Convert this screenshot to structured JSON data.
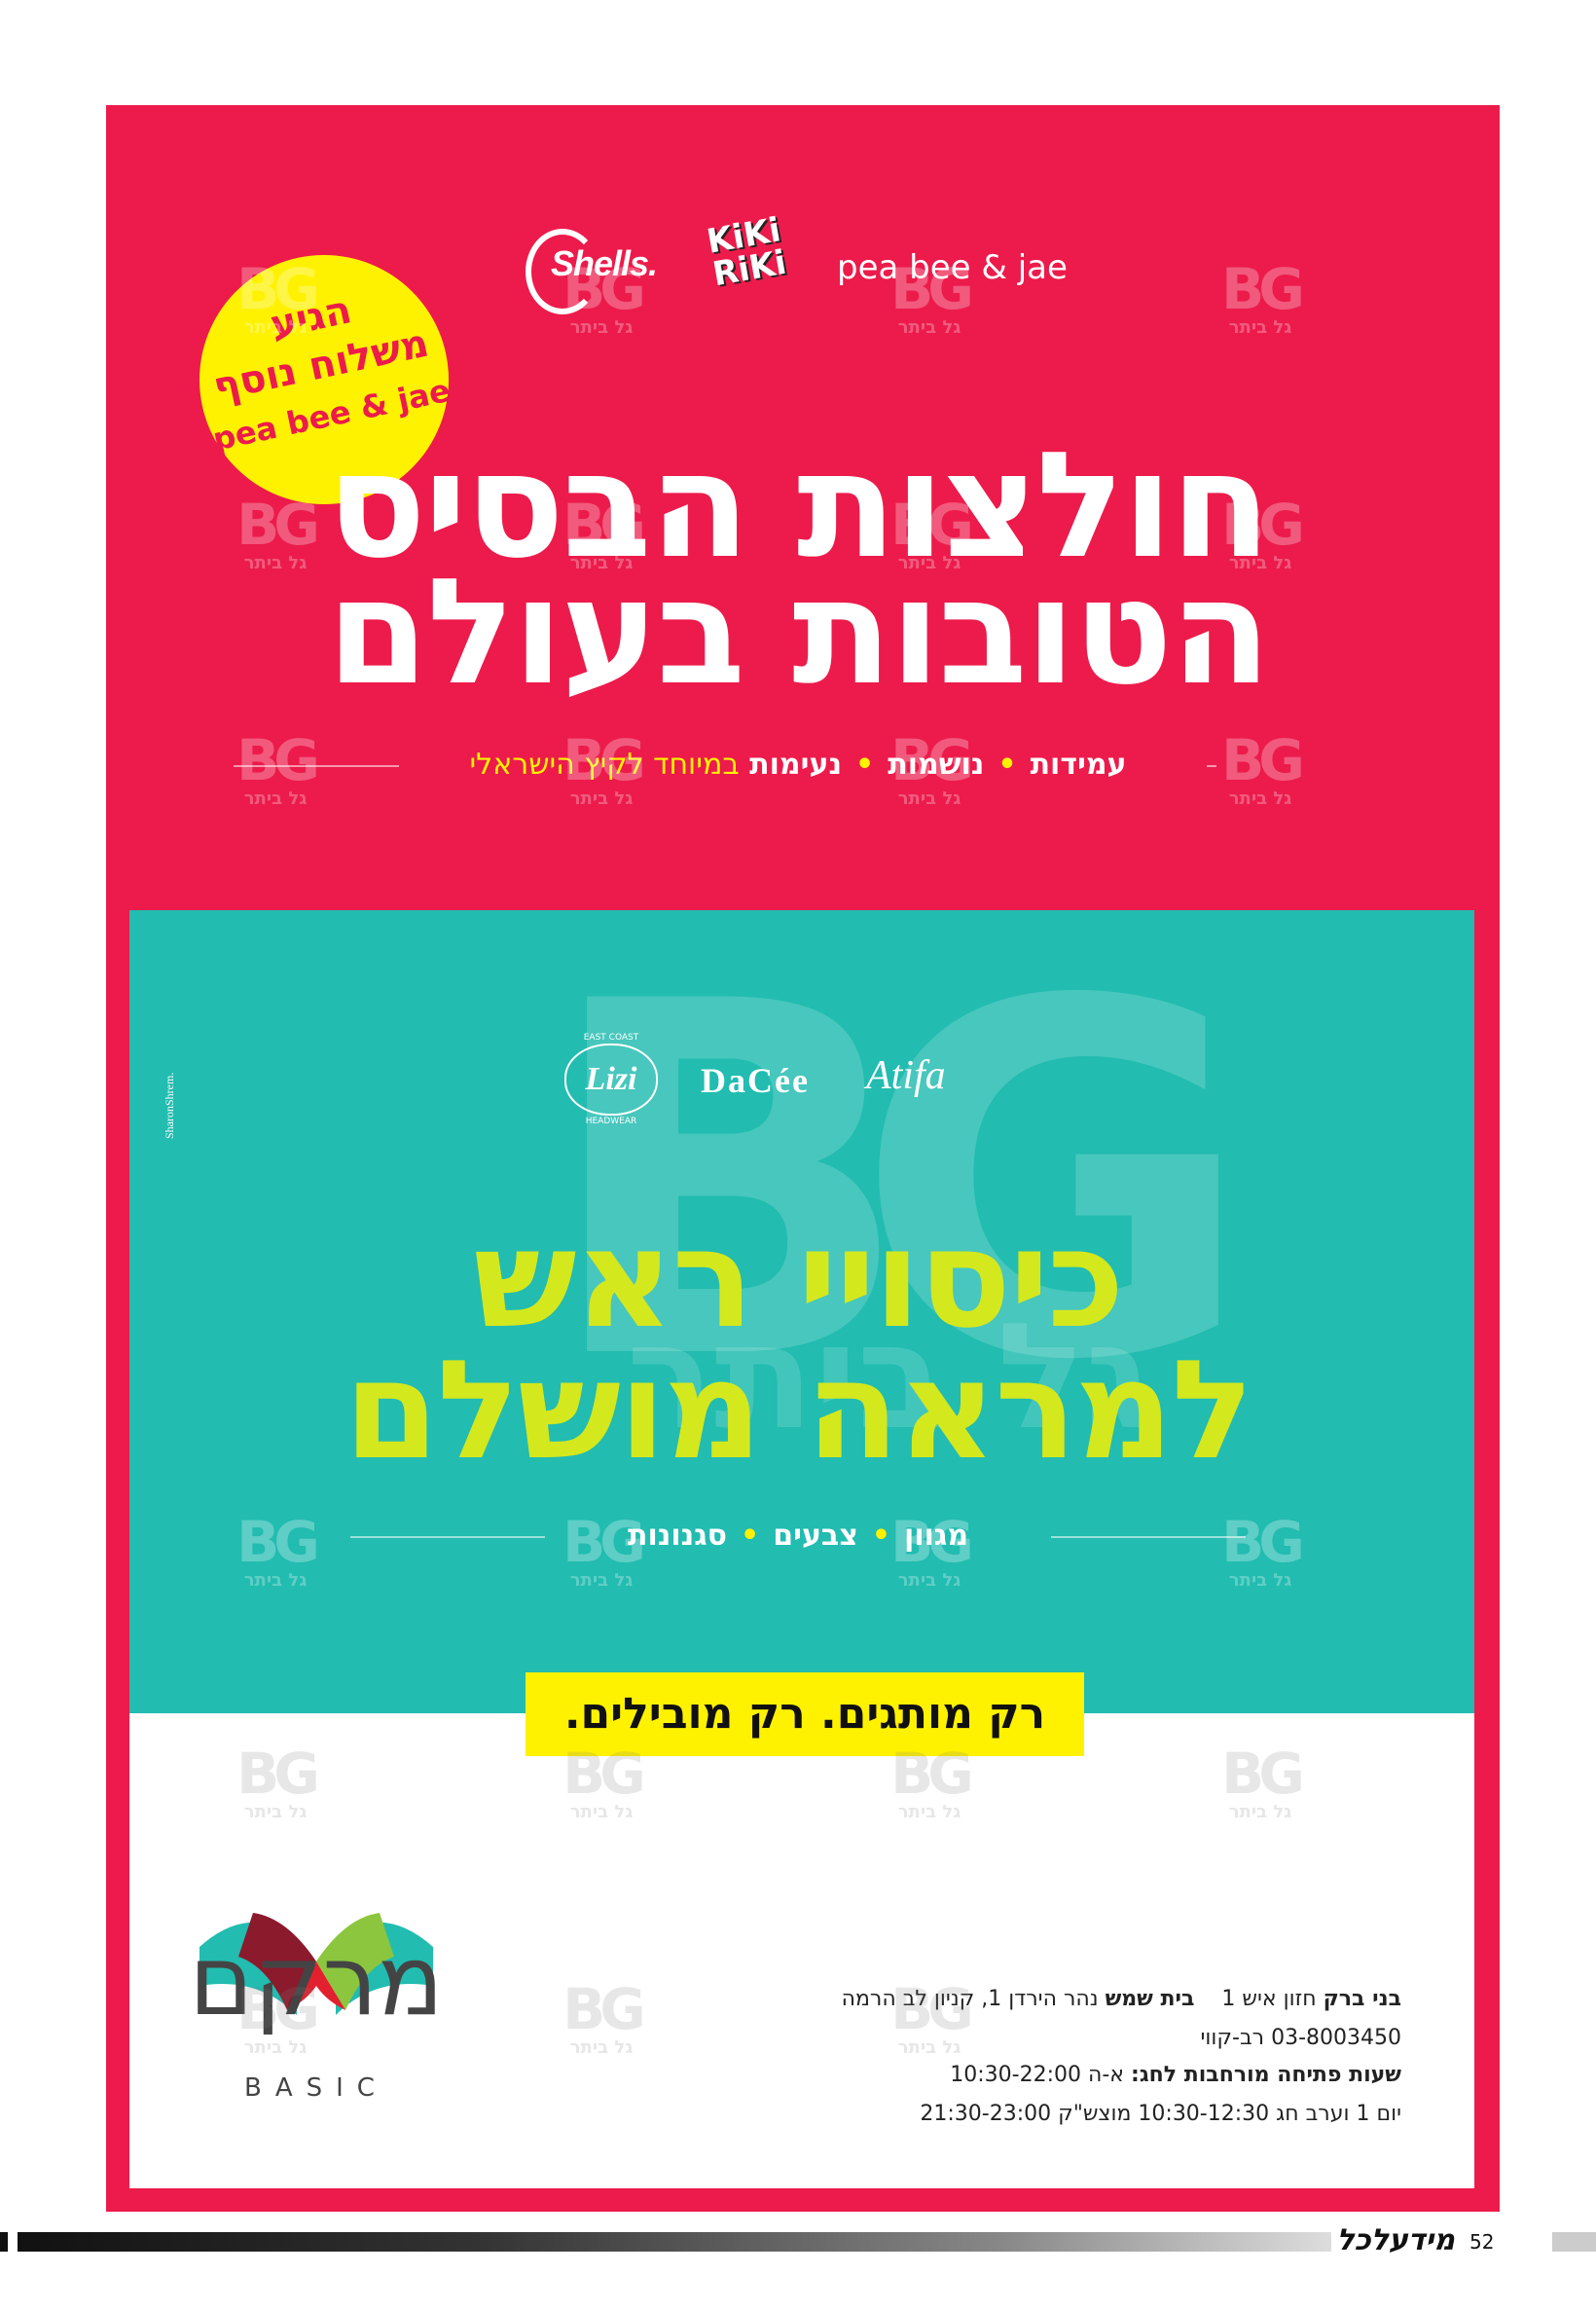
{
  "brands_top": {
    "shells": "Shells.",
    "kiki_line1": "KiKi",
    "kiki_line2": "RiKi",
    "peabee": "pea bee & jae"
  },
  "badge": {
    "line1": "הגיע",
    "line2": "משלוח נוסף",
    "line3": "pea bee & jae"
  },
  "headline_top": {
    "line1": "חולצות הבסיס",
    "line2": "הטובות בעולם"
  },
  "subline_top": {
    "item1": "עמידות",
    "item2": "נושמות",
    "item3": "נעימות",
    "highlight": "במיוחד לקיץ הישראלי"
  },
  "brands_bottom": {
    "lizi": "Lizi",
    "lizi_small_top": "EAST COAST",
    "lizi_small_bottom": "HEADWEAR",
    "dacee": "DaCée",
    "atifa": "Atifa"
  },
  "headline_bottom": {
    "line1": "כיסויי ראש",
    "line2": "למראה מושלם"
  },
  "subline_bottom": {
    "item1": "מגוון",
    "item2": "צבעים",
    "item3": "סגנונות"
  },
  "slogan": "רק מותגים. רק מובילים.",
  "store": {
    "name": "מרקם",
    "sub": "BASIC"
  },
  "address": {
    "line1_city1": "בני ברק",
    "line1_addr1": "חזון איש 1",
    "line1_city2": "בית שמש",
    "line1_addr2": "נהר הירדן 1, קניון לב הרמה",
    "line2": "03-8003450 רב-קווי",
    "line3_label": "שעות פתיחה מורחבות לחג:",
    "line3_value": "א-ה 10:30-22:00",
    "line4": "יום 1 וערב חג 10:30-12:30   מוצש\"ק 21:30-23:00"
  },
  "watermark": {
    "logo": "BG",
    "text": "גל ביתר",
    "big_text": "גל ביתר"
  },
  "credit": "SharonShrem.",
  "footer": {
    "magazine": "מידעלכל",
    "page": "52"
  },
  "colors": {
    "red": "#ec1b4b",
    "teal": "#22bcb0",
    "yellow": "#fff200",
    "lime": "#d4e81e"
  }
}
